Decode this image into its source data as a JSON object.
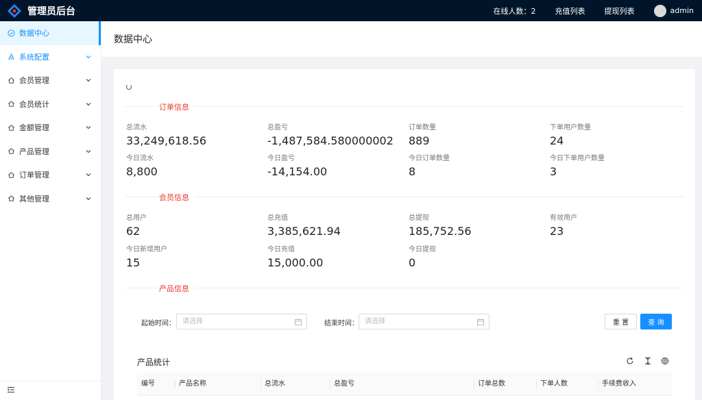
{
  "header": {
    "app_title": "管理员后台",
    "online_label": "在线人数：2",
    "recharge_list": "充值列表",
    "withdraw_list": "提现列表",
    "username": "admin"
  },
  "sidebar": {
    "items": [
      {
        "label": "数据中心",
        "icon": "dashboard-icon"
      },
      {
        "label": "系统配置",
        "icon": "settings-icon"
      },
      {
        "label": "会员管理",
        "icon": "home-icon"
      },
      {
        "label": "会员统计",
        "icon": "home-icon"
      },
      {
        "label": "金额管理",
        "icon": "home-icon"
      },
      {
        "label": "产品管理",
        "icon": "home-icon"
      },
      {
        "label": "订单管理",
        "icon": "home-icon"
      },
      {
        "label": "其他管理",
        "icon": "home-icon"
      }
    ]
  },
  "page": {
    "title": "数据中心"
  },
  "sections": {
    "order": "订单信息",
    "member": "会员信息",
    "product": "产品信息"
  },
  "order_stats": [
    {
      "label": "总流水",
      "value": "33,249,618.56"
    },
    {
      "label": "总盈亏",
      "value": "-1,487,584.580000002"
    },
    {
      "label": "订单数量",
      "value": "889"
    },
    {
      "label": "下单用户数量",
      "value": "24"
    },
    {
      "label": "今日流水",
      "value": "8,800"
    },
    {
      "label": "今日盈亏",
      "value": "-14,154.00"
    },
    {
      "label": "今日订单数量",
      "value": "8"
    },
    {
      "label": "今日下单用户数量",
      "value": "3"
    }
  ],
  "member_stats": [
    {
      "label": "总用户",
      "value": "62"
    },
    {
      "label": "总充值",
      "value": "3,385,621.94"
    },
    {
      "label": "总提现",
      "value": "185,752.56"
    },
    {
      "label": "有效用户",
      "value": "23"
    },
    {
      "label": "今日新增用户",
      "value": "15"
    },
    {
      "label": "今日充值",
      "value": "15,000.00"
    },
    {
      "label": "今日提现",
      "value": "0"
    }
  ],
  "filters": {
    "start_label": "起始时间：",
    "end_label": "结束时间：",
    "placeholder": "请选择",
    "reset": "重 置",
    "query": "查 询"
  },
  "product_table": {
    "title": "产品统计",
    "columns": [
      "编号",
      "产品名称",
      "总流水",
      "总盈亏",
      "订单总数",
      "下单人数",
      "手续费收入"
    ]
  },
  "colors": {
    "header_bg": "#001529",
    "accent": "#1890ff",
    "section_title": "#e8362a"
  }
}
